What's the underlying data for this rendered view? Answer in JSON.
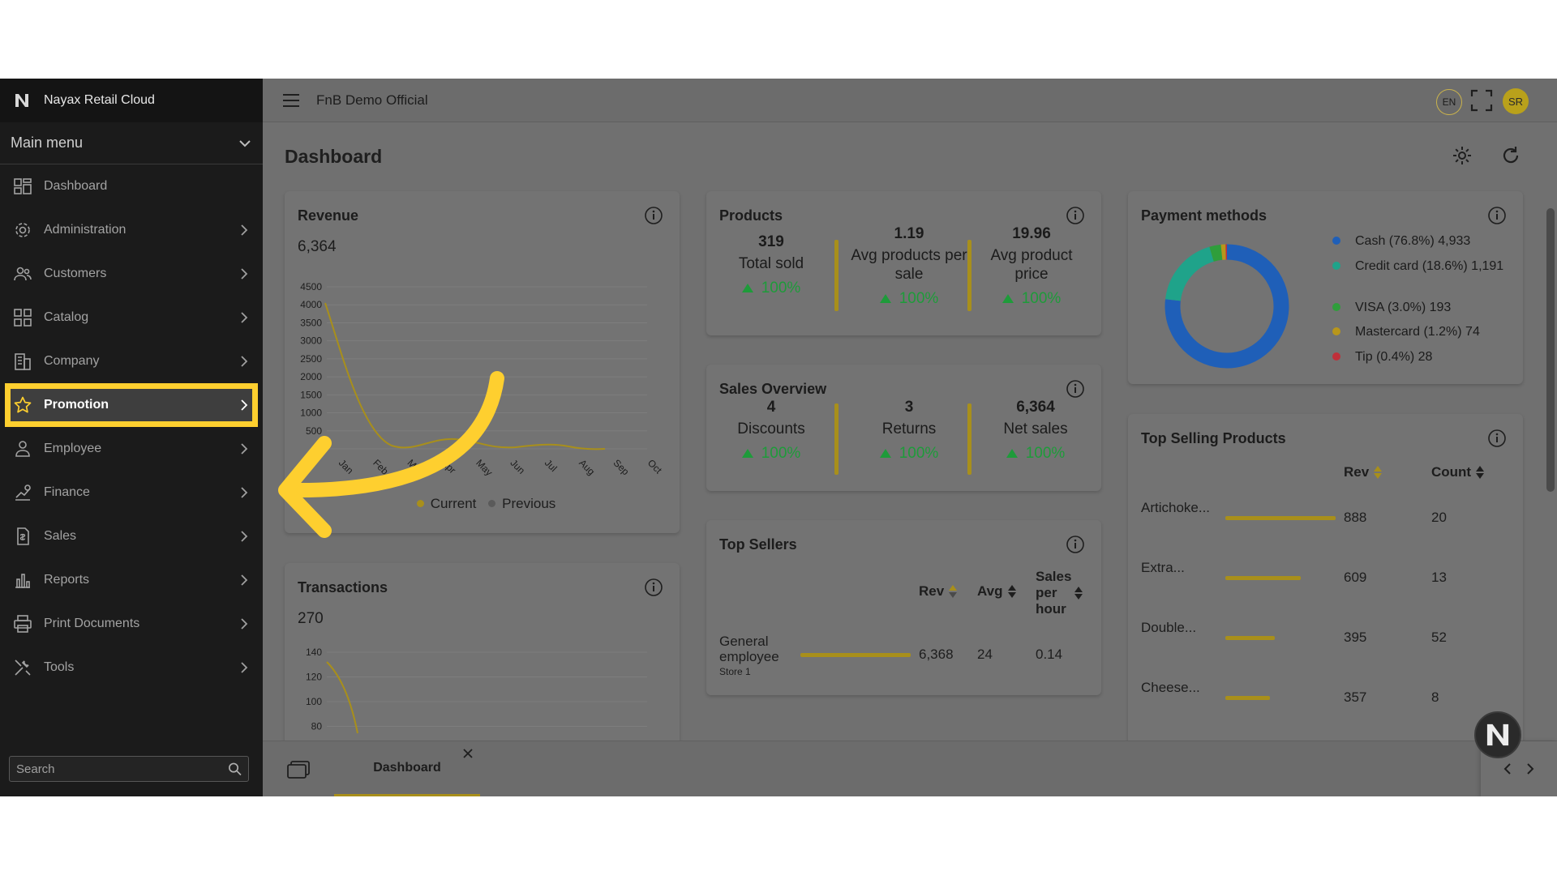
{
  "app": {
    "name": "Nayax Retail Cloud",
    "store": "FnB Demo Official",
    "lang": "EN",
    "avatar": "SR"
  },
  "sidebar": {
    "section": "Main menu",
    "items": [
      {
        "label": "Dashboard",
        "icon": "dashboard-icon",
        "chevron": false
      },
      {
        "label": "Administration",
        "icon": "admin-gear-icon",
        "chevron": true
      },
      {
        "label": "Customers",
        "icon": "customers-icon",
        "chevron": true
      },
      {
        "label": "Catalog",
        "icon": "catalog-grid-icon",
        "chevron": true
      },
      {
        "label": "Company",
        "icon": "company-building-icon",
        "chevron": true
      },
      {
        "label": "Promotion",
        "icon": "star-icon",
        "chevron": true,
        "active": true
      },
      {
        "label": "Employee",
        "icon": "employee-icon",
        "chevron": true
      },
      {
        "label": "Finance",
        "icon": "finance-icon",
        "chevron": true
      },
      {
        "label": "Sales",
        "icon": "sales-icon",
        "chevron": true
      },
      {
        "label": "Reports",
        "icon": "reports-chart-icon",
        "chevron": true
      },
      {
        "label": "Print Documents",
        "icon": "printer-icon",
        "chevron": true
      },
      {
        "label": "Tools",
        "icon": "tools-icon",
        "chevron": true
      }
    ],
    "search_placeholder": "Search"
  },
  "page": {
    "title": "Dashboard"
  },
  "revenue": {
    "title": "Revenue",
    "total": "6,364",
    "y_ticks": [
      "4500",
      "4000",
      "3500",
      "3000",
      "2500",
      "2000",
      "1500",
      "1000",
      "500",
      "0"
    ],
    "months": [
      "Jan",
      "Feb",
      "Mar",
      "Apr",
      "May",
      "Jun",
      "Jul",
      "Aug",
      "Sep",
      "Oct"
    ],
    "legend_current": "Current",
    "legend_previous": "Previous"
  },
  "transactions": {
    "title": "Transactions",
    "total": "270",
    "y_ticks": [
      "140",
      "120",
      "100",
      "80"
    ]
  },
  "products": {
    "title": "Products",
    "kpis": [
      {
        "value": "319",
        "label": "Total sold",
        "pct": "100%"
      },
      {
        "value": "1.19",
        "label": "Avg products per sale",
        "pct": "100%"
      },
      {
        "value": "19.96",
        "label": "Avg product price",
        "pct": "100%"
      }
    ]
  },
  "sales_overview": {
    "title": "Sales Overview",
    "kpis": [
      {
        "value": "4",
        "label": "Discounts",
        "pct": "100%"
      },
      {
        "value": "3",
        "label": "Returns",
        "pct": "100%"
      },
      {
        "value": "6,364",
        "label": "Net sales",
        "pct": "100%"
      }
    ]
  },
  "top_sellers": {
    "title": "Top Sellers",
    "headers": {
      "rev": "Rev",
      "avg": "Avg",
      "sales_per_hour": "Sales per hour"
    },
    "rows": [
      {
        "name": "General employee",
        "store": "Store 1",
        "rev": "6,368",
        "avg": "24",
        "sph": "0.14",
        "rev_fraction": 1.0
      }
    ]
  },
  "payment_methods": {
    "title": "Payment methods",
    "items": [
      {
        "label": "Cash (76.8%) 4,933",
        "color": "#1f5fb8",
        "share": 76.8
      },
      {
        "label": "Credit card (18.6%) 1,191",
        "color": "#1fa38a",
        "share": 18.6
      },
      {
        "label": "VISA (3.0%) 193",
        "color": "#2f9e3b",
        "share": 3.0
      },
      {
        "label": "Mastercard (1.2%) 74",
        "color": "#b8961b",
        "share": 1.2
      },
      {
        "label": "Tip (0.4%) 28",
        "color": "#c0303a",
        "share": 0.4
      }
    ]
  },
  "top_selling": {
    "title": "Top Selling Products",
    "headers": {
      "rev": "Rev",
      "count": "Count"
    },
    "rows": [
      {
        "name": "Artichoke...",
        "rev": "888",
        "count": "20",
        "fraction": 1.0
      },
      {
        "name": "Extra...",
        "rev": "609",
        "count": "13",
        "fraction": 0.686
      },
      {
        "name": "Double...",
        "rev": "395",
        "count": "52",
        "fraction": 0.445
      },
      {
        "name": "Cheese...",
        "rev": "357",
        "count": "8",
        "fraction": 0.402
      }
    ]
  },
  "tabs": [
    {
      "label": "Dashboard"
    }
  ],
  "colors": {
    "accent": "#fecf2f",
    "positive": "#1e9b3a",
    "bar": "#a88f1b"
  }
}
